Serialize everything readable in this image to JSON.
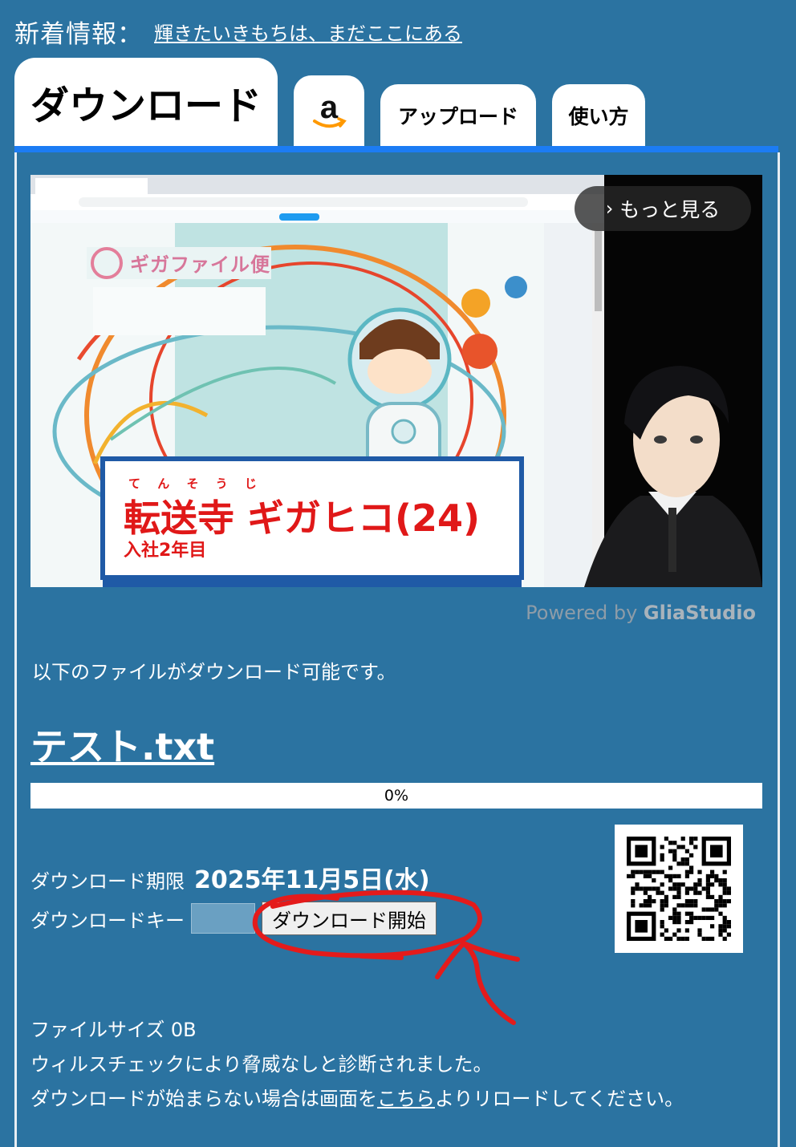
{
  "news": {
    "label": "新着情報：",
    "link_text": "輝きたいきもちは、まだここにある"
  },
  "tabs": {
    "download": "ダウンロード",
    "amazon_icon": "amazon-logo",
    "upload": "アップロード",
    "howto": "使い方"
  },
  "video": {
    "more_button": "もっと見る",
    "caption_ruby": "て ん そ う じ",
    "caption_name": "転送寺 ギガヒコ(24)",
    "caption_sub": "入社2年目",
    "brand_logo": "ギガファイル便"
  },
  "powered_by": {
    "prefix": "Powered by ",
    "brand": "GliaStudio"
  },
  "intro_text": "以下のファイルがダウンロード可能です。",
  "file": {
    "name": "テスト.txt",
    "progress_text": "0%",
    "progress": 0
  },
  "download_limit": {
    "label": "ダウンロード期限",
    "value": "2025年11月5日(水)"
  },
  "download_key": {
    "label": "ダウンロードキー",
    "value": ""
  },
  "download_button": "ダウンロード開始",
  "info": {
    "file_size": "ファイルサイズ 0B",
    "virus_check": "ウィルスチェックにより脅威なしと診断されました。",
    "reload_prefix": "ダウンロードが始まらない場合は画面を",
    "reload_link": "こちら",
    "reload_suffix": "よりリロードしてください。"
  },
  "colors": {
    "background": "#2b73a1",
    "tab_bar": "#1c7cf4",
    "annotation": "#e41b1b",
    "caption_red": "#e01818"
  }
}
